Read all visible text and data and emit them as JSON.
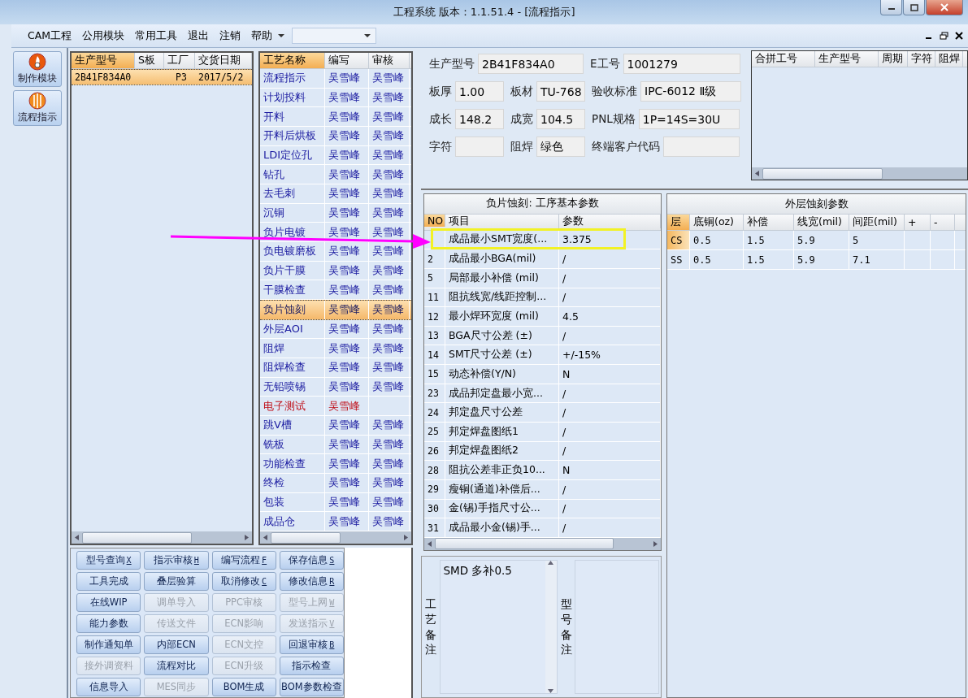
{
  "window": {
    "title": "工程系统  版本：1.1.51.4 - [流程指示]"
  },
  "menu": [
    "CAM工程",
    "公用模块",
    "常用工具",
    "退出",
    "注销",
    "帮助"
  ],
  "nav": [
    {
      "label": "制作模块",
      "kind": "flame"
    },
    {
      "label": "流程指示",
      "kind": "globe"
    }
  ],
  "orders": {
    "columns": [
      "生产型号",
      "S板",
      "工厂",
      "交货日期"
    ],
    "rows": [
      {
        "model": "2B41F834A0",
        "factory": "P3",
        "date": "2017/5/2",
        "selected": true
      }
    ]
  },
  "process": {
    "columns": [
      "工艺名称",
      "编写",
      "审核"
    ],
    "rows": [
      {
        "name": "流程指示",
        "writer": "吴雪峰",
        "reviewer": "吴雪峰",
        "selected": false,
        "pending": false
      },
      {
        "name": "计划投料",
        "writer": "吴雪峰",
        "reviewer": "吴雪峰",
        "selected": false,
        "pending": false
      },
      {
        "name": "开料",
        "writer": "吴雪峰",
        "reviewer": "吴雪峰",
        "selected": false,
        "pending": false
      },
      {
        "name": "开料后烘板",
        "writer": "吴雪峰",
        "reviewer": "吴雪峰",
        "selected": false,
        "pending": false
      },
      {
        "name": "LDI定位孔",
        "writer": "吴雪峰",
        "reviewer": "吴雪峰",
        "selected": false,
        "pending": false
      },
      {
        "name": "钻孔",
        "writer": "吴雪峰",
        "reviewer": "吴雪峰",
        "selected": false,
        "pending": false
      },
      {
        "name": "去毛刺",
        "writer": "吴雪峰",
        "reviewer": "吴雪峰",
        "selected": false,
        "pending": false
      },
      {
        "name": "沉铜",
        "writer": "吴雪峰",
        "reviewer": "吴雪峰",
        "selected": false,
        "pending": false
      },
      {
        "name": "负片电镀",
        "writer": "吴雪峰",
        "reviewer": "吴雪峰",
        "selected": false,
        "pending": false
      },
      {
        "name": "负电镀磨板",
        "writer": "吴雪峰",
        "reviewer": "吴雪峰",
        "selected": false,
        "pending": false
      },
      {
        "name": "负片干膜",
        "writer": "吴雪峰",
        "reviewer": "吴雪峰",
        "selected": false,
        "pending": false
      },
      {
        "name": "干膜检查",
        "writer": "吴雪峰",
        "reviewer": "吴雪峰",
        "selected": false,
        "pending": false
      },
      {
        "name": "负片蚀刻",
        "writer": "吴雪峰",
        "reviewer": "吴雪峰",
        "selected": true,
        "pending": false
      },
      {
        "name": "外层AOI",
        "writer": "吴雪峰",
        "reviewer": "吴雪峰",
        "selected": false,
        "pending": false
      },
      {
        "name": "阻焊",
        "writer": "吴雪峰",
        "reviewer": "吴雪峰",
        "selected": false,
        "pending": false
      },
      {
        "name": "阻焊检查",
        "writer": "吴雪峰",
        "reviewer": "吴雪峰",
        "selected": false,
        "pending": false
      },
      {
        "name": "无铅喷锡",
        "writer": "吴雪峰",
        "reviewer": "吴雪峰",
        "selected": false,
        "pending": false
      },
      {
        "name": "电子测试",
        "writer": "吴雪峰",
        "selected": false,
        "pending": true
      },
      {
        "name": "跳V槽",
        "writer": "吴雪峰",
        "reviewer": "吴雪峰",
        "selected": false,
        "pending": false
      },
      {
        "name": "铣板",
        "writer": "吴雪峰",
        "reviewer": "吴雪峰",
        "selected": false,
        "pending": false
      },
      {
        "name": "功能检查",
        "writer": "吴雪峰",
        "reviewer": "吴雪峰",
        "selected": false,
        "pending": false
      },
      {
        "name": "终检",
        "writer": "吴雪峰",
        "reviewer": "吴雪峰",
        "selected": false,
        "pending": false
      },
      {
        "name": "包装",
        "writer": "吴雪峰",
        "reviewer": "吴雪峰",
        "selected": false,
        "pending": false
      },
      {
        "name": "成品仓",
        "writer": "吴雪峰",
        "reviewer": "吴雪峰",
        "selected": false,
        "pending": false
      }
    ]
  },
  "actions": [
    {
      "label": "型号查询",
      "key": "X",
      "disabled": false
    },
    {
      "label": "指示审核",
      "key": "H",
      "disabled": false
    },
    {
      "label": "编写流程",
      "key": "F",
      "disabled": false
    },
    {
      "label": "保存信息",
      "key": "S",
      "disabled": false
    },
    {
      "label": "工具完成",
      "disabled": false
    },
    {
      "label": "叠层验算",
      "disabled": false
    },
    {
      "label": "取消修改",
      "key": "C",
      "disabled": false
    },
    {
      "label": "修改信息",
      "key": "R",
      "disabled": false
    },
    {
      "label": "在线WIP",
      "disabled": false
    },
    {
      "label": "调单导入",
      "disabled": true
    },
    {
      "label": "PPC审核",
      "disabled": true
    },
    {
      "label": "型号上网",
      "key": "W",
      "disabled": true
    },
    {
      "label": "能力参数",
      "disabled": false
    },
    {
      "label": "传送文件",
      "disabled": true
    },
    {
      "label": "ECN影响",
      "disabled": true
    },
    {
      "label": "发送指示",
      "key": "V",
      "disabled": true
    },
    {
      "label": "制作通知单",
      "disabled": false
    },
    {
      "label": "内部ECN",
      "disabled": false
    },
    {
      "label": "ECN文控",
      "disabled": true
    },
    {
      "label": "回退审核",
      "key": "B",
      "disabled": false
    },
    {
      "label": "接外调资料",
      "disabled": true
    },
    {
      "label": "流程对比",
      "disabled": false
    },
    {
      "label": "ECN升级",
      "disabled": true
    },
    {
      "label": "指示检查",
      "disabled": false
    },
    {
      "label": "信息导入",
      "disabled": false
    },
    {
      "label": "MES同步",
      "disabled": true
    },
    {
      "label": "BOM生成",
      "disabled": false
    },
    {
      "label": "BOM参数检查",
      "disabled": false
    }
  ],
  "info": [
    [
      {
        "label": "生产型号",
        "value": "2B41F834A0"
      },
      {
        "label": "E工号",
        "value": "1001279"
      }
    ],
    [
      {
        "label": "板厚",
        "value": "1.00"
      },
      {
        "label": "板材",
        "value": "TU-768"
      },
      {
        "label": "验收标准",
        "value": "IPC-6012 Ⅱ级"
      }
    ],
    [
      {
        "label": "成长",
        "value": "148.2"
      },
      {
        "label": "成宽",
        "value": "104.5"
      },
      {
        "label": "PNL规格",
        "value": "1P=14S=30U"
      }
    ],
    [
      {
        "label": "字符"
      },
      {
        "label": "阻焊",
        "value": "绿色"
      },
      {
        "label": "终端客户代码"
      }
    ]
  ],
  "combined": {
    "columns": [
      "合拼工号",
      "生产型号",
      "周期",
      "字符",
      "阻焊"
    ]
  },
  "params": {
    "title": "负片蚀刻: 工序基本参数",
    "columns": [
      "NO",
      "项目",
      "参数"
    ],
    "rows": [
      {
        "item": "成品最小SMT宽度(...",
        "value": "3.375"
      },
      {
        "no": "2",
        "item": "成品最小BGA(mil)",
        "value": "/"
      },
      {
        "no": "5",
        "item": "局部最小补偿 (mil)",
        "value": "/"
      },
      {
        "no": "11",
        "item": "阻抗线宽/线距控制...",
        "value": "/"
      },
      {
        "no": "12",
        "item": "最小焊环宽度 (mil)",
        "value": "4.5"
      },
      {
        "no": "13",
        "item": "BGA尺寸公差 (±)",
        "value": "/"
      },
      {
        "no": "14",
        "item": "SMT尺寸公差 (±)",
        "value": "+/-15%"
      },
      {
        "no": "15",
        "item": "动态补偿(Y/N)",
        "value": "N"
      },
      {
        "no": "23",
        "item": "成品邦定盘最小宽...",
        "value": "/"
      },
      {
        "no": "24",
        "item": "邦定盘尺寸公差",
        "value": "/"
      },
      {
        "no": "25",
        "item": "邦定焊盘图纸1",
        "value": "/"
      },
      {
        "no": "26",
        "item": "邦定焊盘图纸2",
        "value": "/"
      },
      {
        "no": "28",
        "item": "阻抗公差非正负10...",
        "value": "N"
      },
      {
        "no": "29",
        "item": "瘦铜(通道)补偿后...",
        "value": "/"
      },
      {
        "no": "30",
        "item": "金(锡)手指尺寸公...",
        "value": "/"
      },
      {
        "no": "31",
        "item": "成品最小金(锡)手...",
        "value": "/"
      }
    ]
  },
  "etch": {
    "title": "外层蚀刻参数",
    "columns": [
      "层",
      "底铜(oz)",
      "补偿",
      "线宽(mil)",
      "间距(mil)",
      "+",
      "-"
    ],
    "rows": [
      {
        "cells": [
          "CS",
          "0.5",
          "1.5",
          "5.9",
          "5"
        ],
        "selected": true
      },
      {
        "cells": [
          "SS",
          "0.5",
          "1.5",
          "5.9",
          "7.1"
        ],
        "selected": false
      }
    ]
  },
  "remarks": [
    {
      "label": "工艺备注",
      "value": "SMD 多补0.5"
    },
    {
      "label": "型号备注"
    }
  ],
  "annotations": {
    "arrow": true,
    "highlight": true
  }
}
